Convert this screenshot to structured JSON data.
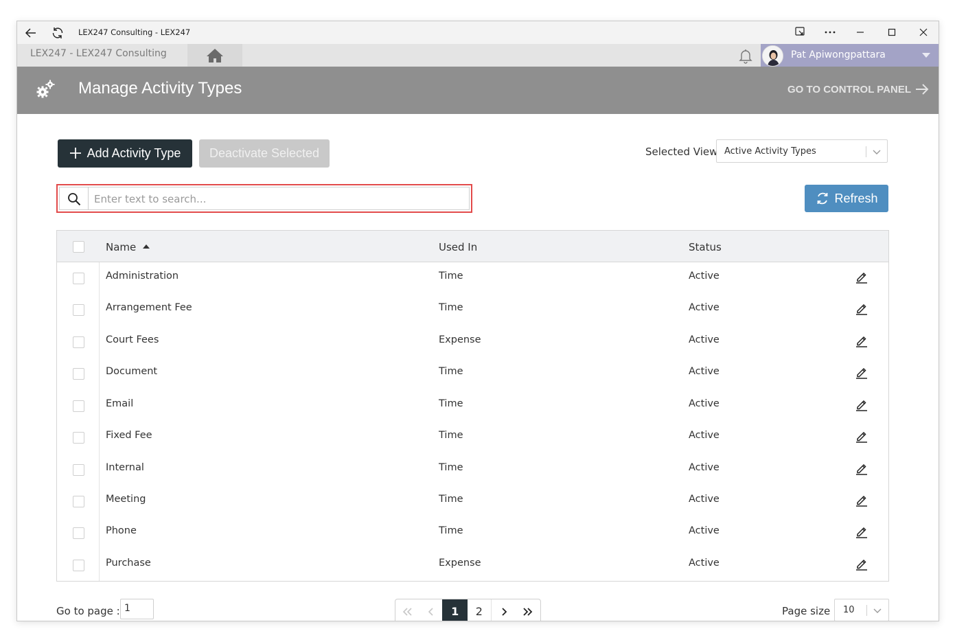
{
  "window": {
    "title": "LEX247 Consulting - LEX247"
  },
  "header": {
    "org_label": "LEX247  -  LEX247 Consulting",
    "user_name": "Pat Apiwongpattara"
  },
  "banner": {
    "title": "Manage Activity Types",
    "control_panel_link": "GO TO CONTROL PANEL"
  },
  "toolbar": {
    "add_label": "Add Activity Type",
    "deactivate_label": "Deactivate Selected",
    "view_label": "Selected View",
    "view_value": "Active Activity Types",
    "refresh_label": "Refresh"
  },
  "search": {
    "placeholder": "Enter text to search...",
    "value": ""
  },
  "grid": {
    "columns": [
      "Name",
      "Used In",
      "Status"
    ],
    "sort": {
      "column": "Name",
      "direction": "ascending"
    },
    "rows": [
      {
        "name": "Administration",
        "used_in": "Time",
        "status": "Active"
      },
      {
        "name": "Arrangement Fee",
        "used_in": "Time",
        "status": "Active"
      },
      {
        "name": "Court Fees",
        "used_in": "Expense",
        "status": "Active"
      },
      {
        "name": "Document",
        "used_in": "Time",
        "status": "Active"
      },
      {
        "name": "Email",
        "used_in": "Time",
        "status": "Active"
      },
      {
        "name": "Fixed Fee",
        "used_in": "Time",
        "status": "Active"
      },
      {
        "name": "Internal",
        "used_in": "Time",
        "status": "Active"
      },
      {
        "name": "Meeting",
        "used_in": "Time",
        "status": "Active"
      },
      {
        "name": "Phone",
        "used_in": "Time",
        "status": "Active"
      },
      {
        "name": "Purchase",
        "used_in": "Expense",
        "status": "Active"
      }
    ]
  },
  "pager": {
    "goto_label": "Go to page :",
    "goto_value": "1",
    "pages": [
      "1",
      "2"
    ],
    "current_page": "1",
    "size_label": "Page size :",
    "size_value": "10"
  },
  "colors": {
    "banner": "#8f8f8f",
    "primary_dark": "#263238",
    "refresh_blue": "#4f8ec0",
    "user_area": "#a3a3c6",
    "search_highlight": "#e24a4a"
  }
}
